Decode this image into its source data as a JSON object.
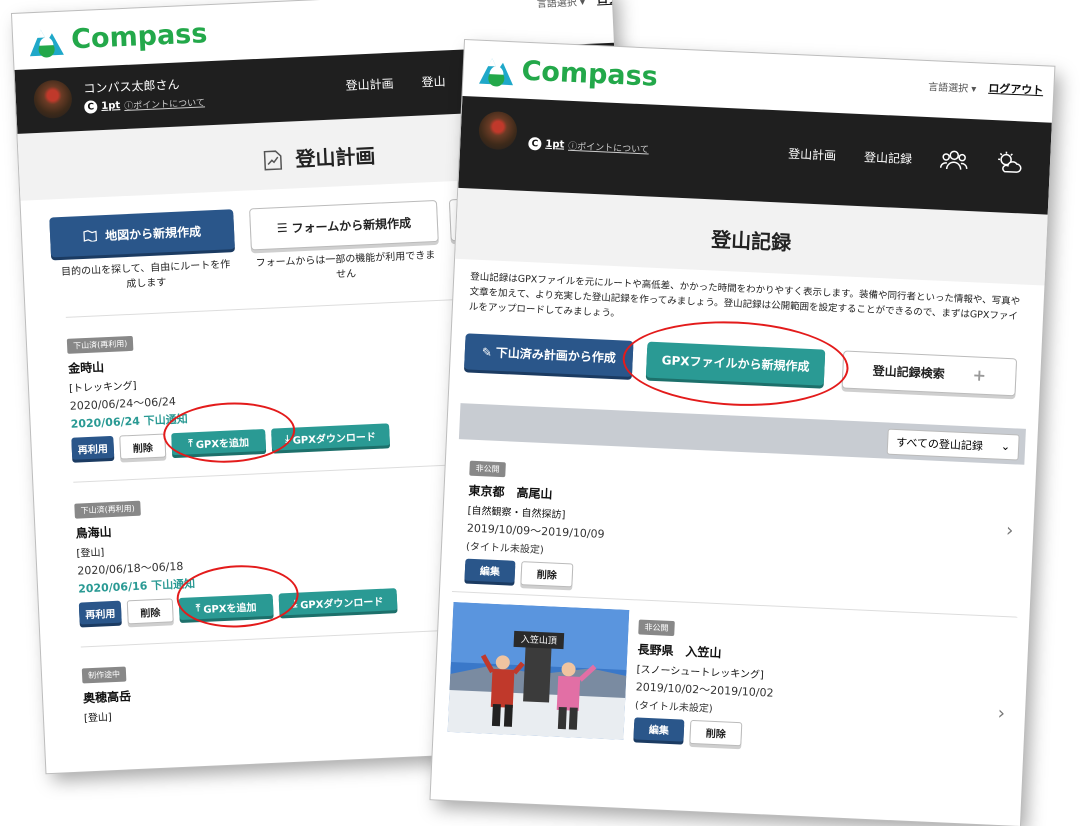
{
  "brand": {
    "name": "Compass"
  },
  "header": {
    "lang_label": "言語選択 ▾",
    "logout": "ログアウト"
  },
  "user": {
    "name": "コンパス太郎さん",
    "points": "1pt",
    "points_help": "ⓘポイントについて"
  },
  "nav": {
    "plan": "登山計画",
    "record": "登山記録",
    "plan_clipped": "登山"
  },
  "left": {
    "title": "登山計画",
    "create_map": "地図から新規作成",
    "create_form": "フォームから新規作成",
    "desc_map": "目的の山を探して、自由にルートを作成します",
    "desc_form": "フォームからは一部の機能が利用できません",
    "items": [
      {
        "status": "下山済(再利用)",
        "mountain": "金時山",
        "category": "[トレッキング]",
        "dates": "2020/06/24〜06/24",
        "down": "2020/06/24 下山通知",
        "reuse": "再利用",
        "delete": "削除",
        "add_gpx": "GPXを追加",
        "download_gpx": "GPXダウンロード"
      },
      {
        "status": "下山済(再利用)",
        "mountain": "鳥海山",
        "category": "[登山]",
        "dates": "2020/06/18〜06/18",
        "down": "2020/06/16 下山通知",
        "reuse": "再利用",
        "delete": "削除",
        "add_gpx": "GPXを追加",
        "download_gpx": "GPXダウンロード"
      },
      {
        "status": "制作途中",
        "mountain": "奥穂高岳",
        "category": "[登山]"
      }
    ]
  },
  "right": {
    "title": "登山記録",
    "description": "登山記録はGPXファイルを元にルートや高低差、かかった時間をわかりやすく表示します。装備や同行者といった情報や、写真や文章を加えて、より充実した登山記録を作ってみましょう。登山記録は公開範囲を設定することができるので、まずはGPXファイルをアップロードしてみましょう。",
    "from_plan": "下山済み計画から作成",
    "from_gpx": "GPXファイルから新規作成",
    "search": "登山記録検索",
    "filter": "すべての登山記録",
    "records": [
      {
        "visibility": "非公開",
        "place": "東京都　高尾山",
        "category": "[自然観察・自然探訪]",
        "dates": "2019/10/09〜2019/10/09",
        "subtitle": "(タイトル未設定)",
        "edit": "編集",
        "delete": "削除"
      },
      {
        "visibility": "非公開",
        "place": "長野県　入笠山",
        "category": "[スノーシュートレッキング]",
        "dates": "2019/10/02〜2019/10/02",
        "subtitle": "(タイトル未設定)",
        "edit": "編集",
        "delete": "削除",
        "photo_sign": "入笠山頂"
      }
    ]
  },
  "colors": {
    "brand_green": "#23a84a",
    "navy": "#2a568a",
    "teal": "#2a9a94",
    "highlight_red": "#e31b1b",
    "navbar": "#1f1f1f"
  },
  "icons": [
    "compass-logo-icon",
    "map-icon",
    "list-icon",
    "pencil-icon",
    "upload-icon",
    "download-icon",
    "group-icon",
    "weather-icon",
    "plus-icon",
    "chevron-down-icon",
    "chevron-right-icon"
  ]
}
